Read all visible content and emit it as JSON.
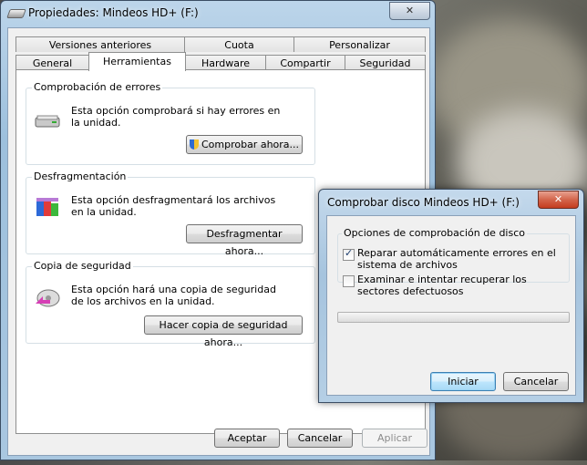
{
  "window": {
    "title": "Propiedades: Mindeos HD+ (F:)",
    "close_label": "✕"
  },
  "tabs": {
    "row1": [
      "Versiones anteriores",
      "Cuota",
      "Personalizar"
    ],
    "row2": [
      "General",
      "Herramientas",
      "Hardware",
      "Compartir",
      "Seguridad"
    ],
    "active": "Herramientas"
  },
  "groups": {
    "error_check": {
      "label": "Comprobación de errores",
      "text": "Esta opción comprobará si hay errores en la unidad.",
      "button": "Comprobar ahora..."
    },
    "defrag": {
      "label": "Desfragmentación",
      "text": "Esta opción desfragmentará los archivos en la unidad.",
      "button": "Desfragmentar ahora..."
    },
    "backup": {
      "label": "Copia de seguridad",
      "text": "Esta opción hará una copia de seguridad de los archivos en la unidad.",
      "button": "Hacer copia de seguridad ahora..."
    }
  },
  "footer": {
    "ok": "Aceptar",
    "cancel": "Cancelar",
    "apply": "Aplicar"
  },
  "dialog": {
    "title": "Comprobar disco Mindeos HD+ (F:)",
    "close_label": "✕",
    "group_label": "Opciones de comprobación de disco",
    "option1": "Reparar automáticamente errores en el sistema de archivos",
    "option1_checked": true,
    "option2": "Examinar e intentar recuperar los sectores defectuosos",
    "option2_checked": false,
    "check_mark": "✓",
    "progress": 0,
    "start": "Iniciar",
    "cancel": "Cancelar"
  },
  "icons": {
    "drive": "drive-icon",
    "shield": "uac-shield-icon",
    "defrag": "defrag-icon",
    "backup": "backup-icon"
  }
}
